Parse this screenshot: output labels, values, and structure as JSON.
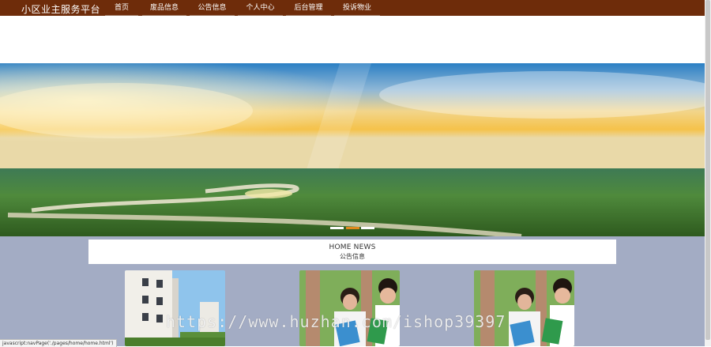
{
  "brand": "小区业主服务平台",
  "nav": [
    "首页",
    "废品信息",
    "公告信息",
    "个人中心",
    "后台管理",
    "投诉物业"
  ],
  "carousel": {
    "slides": 3,
    "active_index": 1
  },
  "news": {
    "title_en": "HOME NEWS",
    "title_zh": "公告信息"
  },
  "cards": [
    "building-photo",
    "people-photo",
    "people-photo"
  ],
  "watermark": "https://www.huzhan.com/ishop39397",
  "status_bar": "javascript:navPage('./pages/home/home.html')",
  "colors": {
    "nav_bg": "#6e2c0a",
    "lower_bg": "#a3acc4",
    "dot_active": "#e08a1e"
  }
}
